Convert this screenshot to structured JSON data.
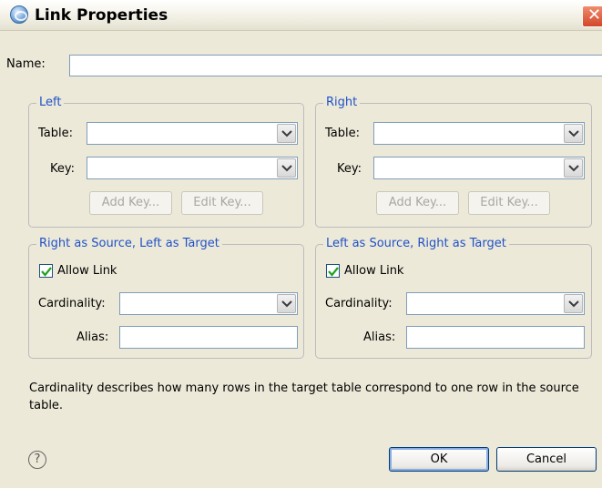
{
  "window": {
    "title": "Link Properties",
    "close_glyph": "✕"
  },
  "name_field": {
    "label": "Name:",
    "value": ""
  },
  "left_group": {
    "legend": "Left",
    "table_label": "Table:",
    "table_value": "",
    "key_label": "Key:",
    "key_value": "",
    "add_key_label": "Add Key...",
    "edit_key_label": "Edit Key..."
  },
  "right_group": {
    "legend": "Right",
    "table_label": "Table:",
    "table_value": "",
    "key_label": "Key:",
    "key_value": "",
    "add_key_label": "Add Key...",
    "edit_key_label": "Edit Key..."
  },
  "rs_lt_group": {
    "legend": "Right as Source, Left as Target",
    "allow_link_label": "Allow Link",
    "allow_link_checked": true,
    "cardinality_label": "Cardinality:",
    "cardinality_value": "",
    "alias_label": "Alias:",
    "alias_value": ""
  },
  "ls_rt_group": {
    "legend": "Left as Source, Right as Target",
    "allow_link_label": "Allow Link",
    "allow_link_checked": true,
    "cardinality_label": "Cardinality:",
    "cardinality_value": "",
    "alias_label": "Alias:",
    "alias_value": ""
  },
  "description": "Cardinality describes how many rows in the target table correspond to one row in the source table.",
  "footer": {
    "help_glyph": "?",
    "ok_label": "OK",
    "cancel_label": "Cancel"
  }
}
